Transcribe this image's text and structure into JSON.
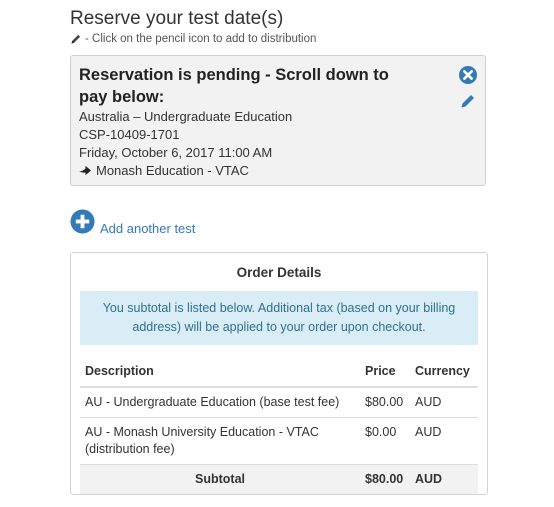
{
  "page": {
    "title": "Reserve your test date(s)",
    "hint": "- Click on the pencil icon to add to distribution"
  },
  "reservation": {
    "heading": "Reservation is pending - Scroll down to pay below:",
    "program": "Australia – Undergraduate Education",
    "code": "CSP-10409-1701",
    "datetime": "Friday, October 6, 2017 11:00 AM",
    "distribution": "Monash Education - VTAC",
    "icons": {
      "remove": "remove-circle-icon",
      "edit": "pencil-icon",
      "arrow": "arrow-right-icon"
    }
  },
  "add_test": {
    "label": "Add another test",
    "icon": "plus-circle-icon"
  },
  "order": {
    "title": "Order Details",
    "info": "You subtotal is listed below. Additional tax (based on your billing address) will be applied to your order upon checkout.",
    "columns": [
      "Description",
      "Price",
      "Currency"
    ],
    "rows": [
      {
        "description": "AU - Undergraduate Education (base test fee)",
        "price": "$80.00",
        "currency": "AUD"
      },
      {
        "description": "AU - Monash University Education - VTAC (distribution fee)",
        "price": "$0.00",
        "currency": "AUD"
      }
    ],
    "subtotal": {
      "label": "Subtotal",
      "price": "$80.00",
      "currency": "AUD"
    }
  },
  "colors": {
    "accent": "#337ab7",
    "info_bg": "#d9edf7",
    "info_text": "#31708f",
    "panel_bg": "#f2f2f2"
  }
}
